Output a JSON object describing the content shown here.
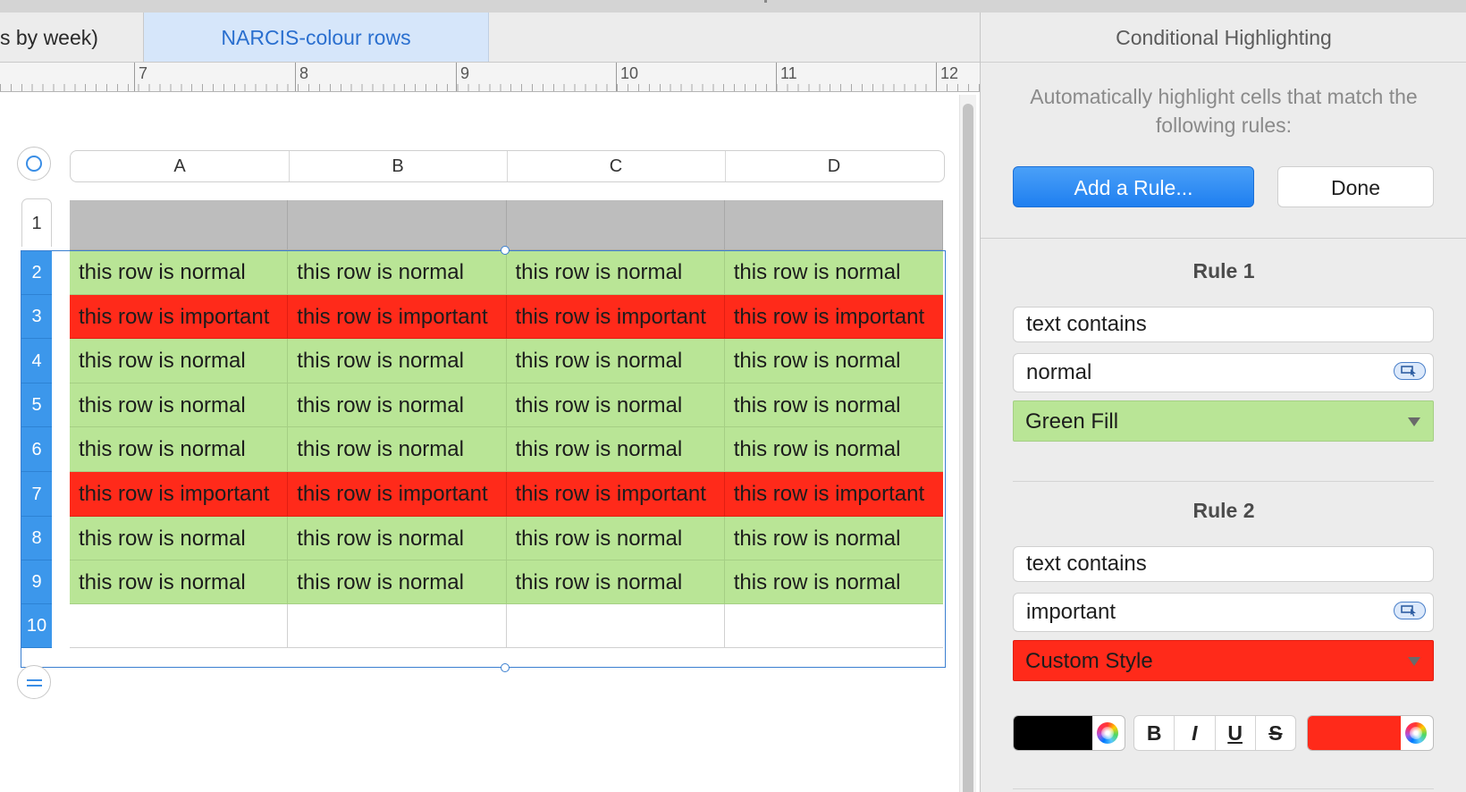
{
  "tabs": [
    {
      "label": "s by week)",
      "active": false
    },
    {
      "label": "NARCIS-colour rows",
      "active": true
    }
  ],
  "ruler": [
    "7",
    "8",
    "9",
    "10",
    "11",
    "12"
  ],
  "columns": [
    "A",
    "B",
    "C",
    "D"
  ],
  "row_numbers": [
    "1",
    "2",
    "3",
    "4",
    "5",
    "6",
    "7",
    "8",
    "9",
    "10"
  ],
  "rows": [
    {
      "num": "1",
      "kind": "hdr",
      "cells": [
        "",
        "",
        "",
        ""
      ]
    },
    {
      "num": "2",
      "kind": "norm",
      "cells": [
        "this row is normal",
        "this row is normal",
        "this row is normal",
        "this row is normal"
      ]
    },
    {
      "num": "3",
      "kind": "imp",
      "cells": [
        "this row is important",
        "this row is important",
        "this row is important",
        "this row is important"
      ]
    },
    {
      "num": "4",
      "kind": "norm",
      "cells": [
        "this row is normal",
        "this row is normal",
        "this row is normal",
        "this row is normal"
      ]
    },
    {
      "num": "5",
      "kind": "norm",
      "cells": [
        "this row is normal",
        "this row is normal",
        "this row is normal",
        "this row is normal"
      ]
    },
    {
      "num": "6",
      "kind": "norm",
      "cells": [
        "this row is normal",
        "this row is normal",
        "this row is normal",
        "this row is normal"
      ]
    },
    {
      "num": "7",
      "kind": "imp",
      "cells": [
        "this row is important",
        "this row is important",
        "this row is important",
        "this row is important"
      ]
    },
    {
      "num": "8",
      "kind": "norm",
      "cells": [
        "this row is normal",
        "this row is normal",
        "this row is normal",
        "this row is normal"
      ]
    },
    {
      "num": "9",
      "kind": "norm",
      "cells": [
        "this row is normal",
        "this row is normal",
        "this row is normal",
        "this row is normal"
      ]
    },
    {
      "num": "10",
      "kind": "blank",
      "cells": [
        "",
        "",
        "",
        ""
      ]
    }
  ],
  "sidebar": {
    "title": "Conditional Highlighting",
    "description": "Automatically highlight cells that match the following rules:",
    "add_rule_label": "Add a Rule...",
    "done_label": "Done",
    "rules": [
      {
        "title": "Rule 1",
        "condition": "text contains",
        "value": "normal",
        "style": "Green Fill",
        "style_color": "#b9e596"
      },
      {
        "title": "Rule 2",
        "condition": "text contains",
        "value": "important",
        "style": "Custom Style",
        "style_color": "#ff2a1a",
        "custom": {
          "text_color": "#000000",
          "fill_color": "#ff2a1a",
          "bold_label": "B",
          "italic_label": "I",
          "underline_label": "U",
          "strike_label": "S"
        }
      }
    ]
  },
  "colors": {
    "normal_fill": "#b9e596",
    "important_fill": "#ff2a1a",
    "selection": "#3a7fd0",
    "accent": "#1f7ff0"
  },
  "icons": [
    "table-select-icon",
    "add-row-icon",
    "cell-reference-icon",
    "color-wheel-icon",
    "popup-arrow-icon"
  ]
}
